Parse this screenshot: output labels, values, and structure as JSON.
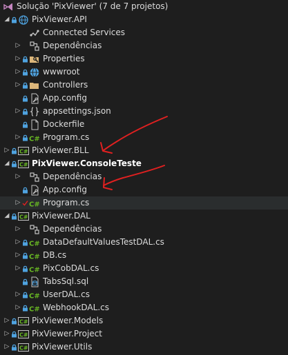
{
  "solution": {
    "label": "Solução 'PixViewer' (7 de 7 projetos)"
  },
  "items": [
    {
      "label": "Solução 'PixViewer' (7 de 7 projetos)",
      "indent": 0,
      "chev": "",
      "lock": false,
      "check": false,
      "icon": "solution-icon"
    },
    {
      "label": "PixViewer.API",
      "indent": 1,
      "chev": "down",
      "lock": true,
      "check": false,
      "icon": "web-project-icon"
    },
    {
      "label": "Connected Services",
      "indent": 2,
      "chev": "",
      "lock": false,
      "check": false,
      "icon": "connected-services-icon"
    },
    {
      "label": "Dependências",
      "indent": 2,
      "chev": "right",
      "lock": false,
      "check": false,
      "icon": "dependencies-icon"
    },
    {
      "label": "Properties",
      "indent": 2,
      "chev": "right",
      "lock": true,
      "check": false,
      "icon": "properties-folder-icon"
    },
    {
      "label": "wwwroot",
      "indent": 2,
      "chev": "right",
      "lock": true,
      "check": false,
      "icon": "globe-icon"
    },
    {
      "label": "Controllers",
      "indent": 2,
      "chev": "right",
      "lock": true,
      "check": false,
      "icon": "folder-icon"
    },
    {
      "label": "App.config",
      "indent": 2,
      "chev": "",
      "lock": true,
      "check": false,
      "icon": "config-icon"
    },
    {
      "label": "appsettings.json",
      "indent": 2,
      "chev": "right",
      "lock": true,
      "check": false,
      "icon": "json-icon"
    },
    {
      "label": "Dockerfile",
      "indent": 2,
      "chev": "",
      "lock": true,
      "check": false,
      "icon": "file-icon"
    },
    {
      "label": "Program.cs",
      "indent": 2,
      "chev": "right",
      "lock": true,
      "check": false,
      "icon": "csharp-icon"
    },
    {
      "label": "PixViewer.BLL",
      "indent": 1,
      "chev": "right",
      "lock": true,
      "check": false,
      "icon": "csharp-project-icon"
    },
    {
      "label": "PixViewer.ConsoleTeste",
      "indent": 1,
      "chev": "down",
      "lock": true,
      "check": false,
      "icon": "csharp-project-icon",
      "bold": true
    },
    {
      "label": "Dependências",
      "indent": 2,
      "chev": "right",
      "lock": false,
      "check": false,
      "icon": "dependencies-icon"
    },
    {
      "label": "App.config",
      "indent": 2,
      "chev": "",
      "lock": true,
      "check": false,
      "icon": "config-icon"
    },
    {
      "label": "Program.cs",
      "indent": 2,
      "chev": "right",
      "lock": false,
      "check": true,
      "icon": "csharp-icon",
      "highlight": true
    },
    {
      "label": "PixViewer.DAL",
      "indent": 1,
      "chev": "down",
      "lock": true,
      "check": false,
      "icon": "csharp-project-icon"
    },
    {
      "label": "Dependências",
      "indent": 2,
      "chev": "right",
      "lock": false,
      "check": false,
      "icon": "dependencies-icon"
    },
    {
      "label": "DataDefaultValuesTestDAL.cs",
      "indent": 2,
      "chev": "right",
      "lock": true,
      "check": false,
      "icon": "csharp-icon"
    },
    {
      "label": "DB.cs",
      "indent": 2,
      "chev": "right",
      "lock": true,
      "check": false,
      "icon": "csharp-icon"
    },
    {
      "label": "PixCobDAL.cs",
      "indent": 2,
      "chev": "right",
      "lock": true,
      "check": false,
      "icon": "csharp-icon"
    },
    {
      "label": "TabsSql.sql",
      "indent": 2,
      "chev": "",
      "lock": true,
      "check": false,
      "icon": "sql-icon"
    },
    {
      "label": "UserDAL.cs",
      "indent": 2,
      "chev": "right",
      "lock": true,
      "check": false,
      "icon": "csharp-icon"
    },
    {
      "label": "WebhookDAL.cs",
      "indent": 2,
      "chev": "right",
      "lock": true,
      "check": false,
      "icon": "csharp-icon"
    },
    {
      "label": "PixViewer.Models",
      "indent": 1,
      "chev": "right",
      "lock": true,
      "check": false,
      "icon": "csharp-project-icon"
    },
    {
      "label": "PixViewer.Project",
      "indent": 1,
      "chev": "right",
      "lock": true,
      "check": false,
      "icon": "csharp-project-icon"
    },
    {
      "label": "PixViewer.Utils",
      "indent": 1,
      "chev": "right",
      "lock": true,
      "check": false,
      "icon": "csharp-project-icon"
    }
  ],
  "colors": {
    "background": "#1e1e1e",
    "text": "#dcdcdc",
    "lock": "#4fa3e0",
    "csharp": "#68b723",
    "annotation": "#e02020",
    "folder": "#dcb67a"
  }
}
